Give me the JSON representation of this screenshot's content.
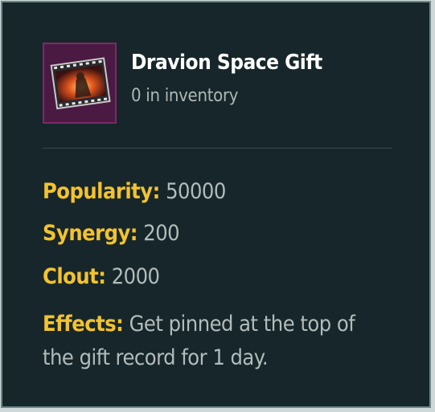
{
  "item": {
    "name": "Dravion Space Gift",
    "inventory": "0 in inventory",
    "icon": "film-frame-gift-icon"
  },
  "stats": {
    "popularity_label": "Popularity:",
    "popularity_value": "50000",
    "synergy_label": "Synergy:",
    "synergy_value": "200",
    "clout_label": "Clout:",
    "clout_value": "2000"
  },
  "effects": {
    "label": "Effects:",
    "text": "Get pinned at the top of the gift record for 1 day."
  },
  "colors": {
    "background": "#16262a",
    "border": "#6e8a8a",
    "label": "#f2c230",
    "value": "#b3bbbb",
    "title": "#ffffff"
  }
}
